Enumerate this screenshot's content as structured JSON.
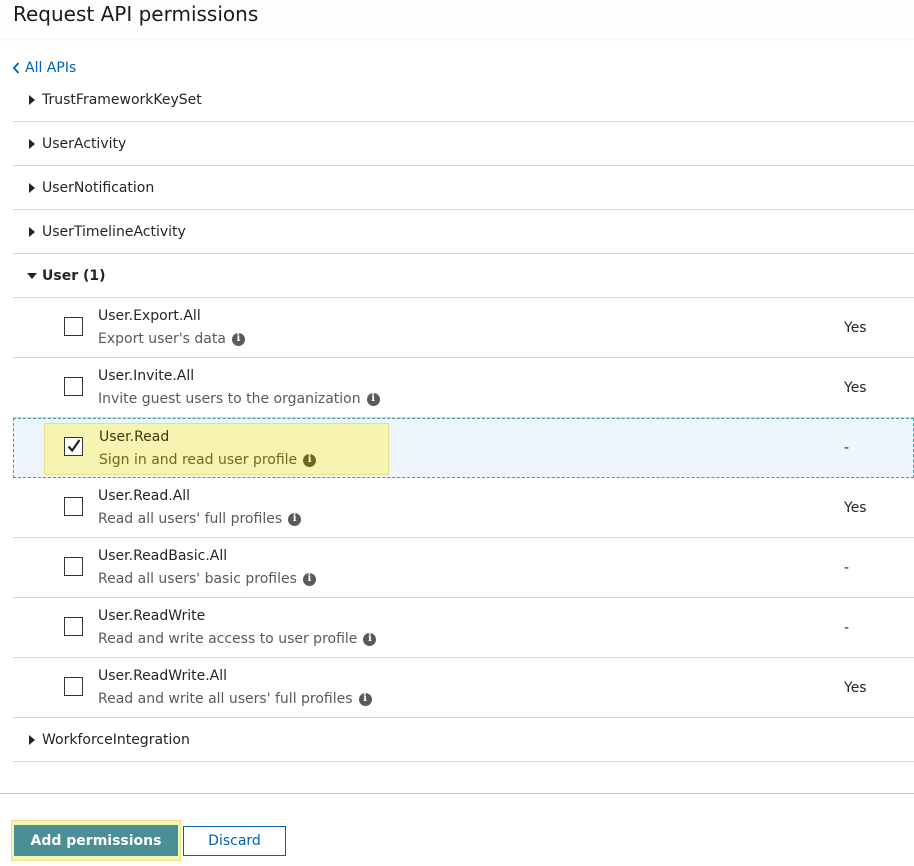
{
  "header": {
    "title": "Request API permissions"
  },
  "nav": {
    "back_label": "All APIs"
  },
  "groups_before": [
    {
      "label": "TrustFrameworkKeySet"
    },
    {
      "label": "UserActivity"
    },
    {
      "label": "UserNotification"
    },
    {
      "label": "UserTimelineActivity"
    }
  ],
  "expanded_group": {
    "label": "User (1)",
    "permissions": [
      {
        "name": "User.Export.All",
        "description": "Export user's data",
        "admin": "Yes",
        "checked": false
      },
      {
        "name": "User.Invite.All",
        "description": "Invite guest users to the organization",
        "admin": "Yes",
        "checked": false
      },
      {
        "name": "User.Read",
        "description": "Sign in and read user profile",
        "admin": "-",
        "checked": true
      },
      {
        "name": "User.Read.All",
        "description": "Read all users' full profiles",
        "admin": "Yes",
        "checked": false
      },
      {
        "name": "User.ReadBasic.All",
        "description": "Read all users' basic profiles",
        "admin": "-",
        "checked": false
      },
      {
        "name": "User.ReadWrite",
        "description": "Read and write access to user profile",
        "admin": "-",
        "checked": false
      },
      {
        "name": "User.ReadWrite.All",
        "description": "Read and write all users' full profiles",
        "admin": "Yes",
        "checked": false
      }
    ]
  },
  "groups_after": [
    {
      "label": "WorkforceIntegration"
    }
  ],
  "footer": {
    "add_label": "Add permissions",
    "discard_label": "Discard"
  },
  "colors": {
    "link": "#0063b1",
    "primary_button": "#4a8f96",
    "highlight": "#f6f4b0",
    "selected_row": "#eef5fc"
  }
}
